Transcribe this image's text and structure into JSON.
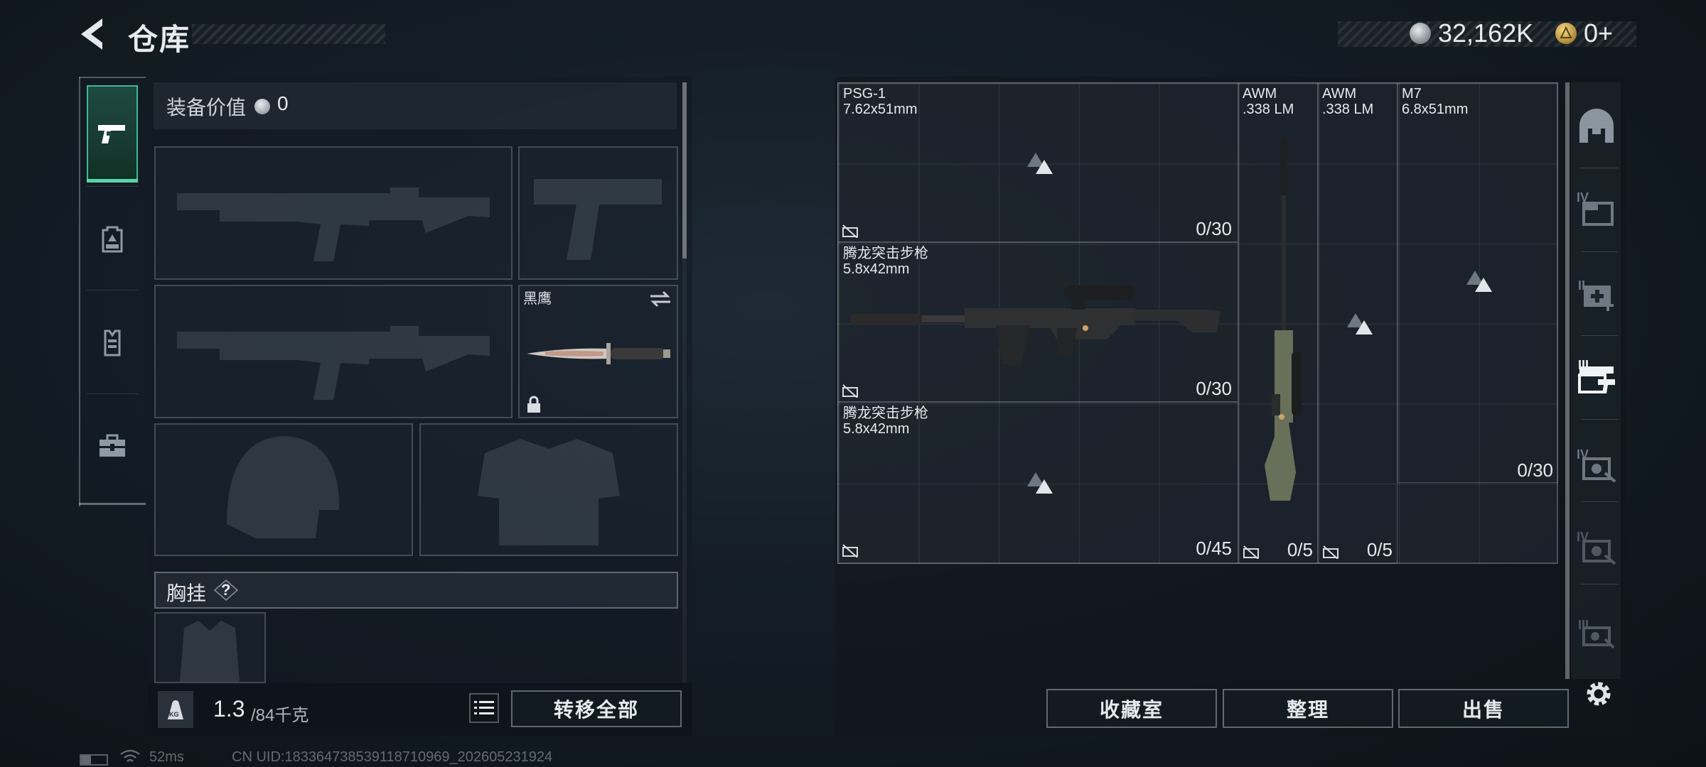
{
  "header": {
    "title": "仓库",
    "silver_amount": "32,162K",
    "gold_amount": "0+"
  },
  "left_rail": {
    "tabs": [
      {
        "icon": "pistol-icon",
        "active": true
      },
      {
        "icon": "backpack-icon",
        "active": false
      },
      {
        "icon": "vest-icon",
        "active": false
      },
      {
        "icon": "toolbox-icon",
        "active": false
      }
    ]
  },
  "equipment": {
    "value_label": "装备价值",
    "value": "0",
    "melee_name": "黑鹰",
    "chest_rig_label": "胸挂",
    "chest_rig_help": "?",
    "weight_current": "1.3",
    "weight_max": "/84千克",
    "weight_icon_text": "KG",
    "transfer_all": "转移全部"
  },
  "status": {
    "ping": "52ms",
    "uid": "CN UID:183364738539118710969_202605231924"
  },
  "stash": {
    "items": [
      {
        "name": "PSG-1",
        "caliber": "7.62x51mm",
        "ammo": "0/30"
      },
      {
        "name": "腾龙突击步枪",
        "caliber": "5.8x42mm",
        "ammo": "0/30"
      },
      {
        "name": "腾龙突击步枪",
        "caliber": "5.8x42mm",
        "ammo": "0/45"
      },
      {
        "name": "AWM",
        "caliber": ".338 LM",
        "ammo": "0/5"
      },
      {
        "name": "AWM",
        "caliber": ".338 LM",
        "ammo": "0/5"
      },
      {
        "name": "M7",
        "caliber": "6.8x51mm",
        "ammo": "0/30"
      }
    ],
    "side_tabs": [
      {
        "icon": "safe-box-icon",
        "tier": ""
      },
      {
        "icon": "storage-crate-icon",
        "tier": "IV"
      },
      {
        "icon": "medical-case-icon",
        "tier": "II"
      },
      {
        "icon": "weapon-rack-icon",
        "tier": "III"
      },
      {
        "icon": "gear-case-icon",
        "tier": "IV"
      },
      {
        "icon": "gear-case-icon",
        "tier": "IV"
      },
      {
        "icon": "ammo-case-icon",
        "tier": "III"
      }
    ],
    "collection_label": "收藏室",
    "organize_label": "整理",
    "sell_label": "出售"
  },
  "colors": {
    "accent_green": "#58d5a8",
    "background": "#141d26"
  }
}
